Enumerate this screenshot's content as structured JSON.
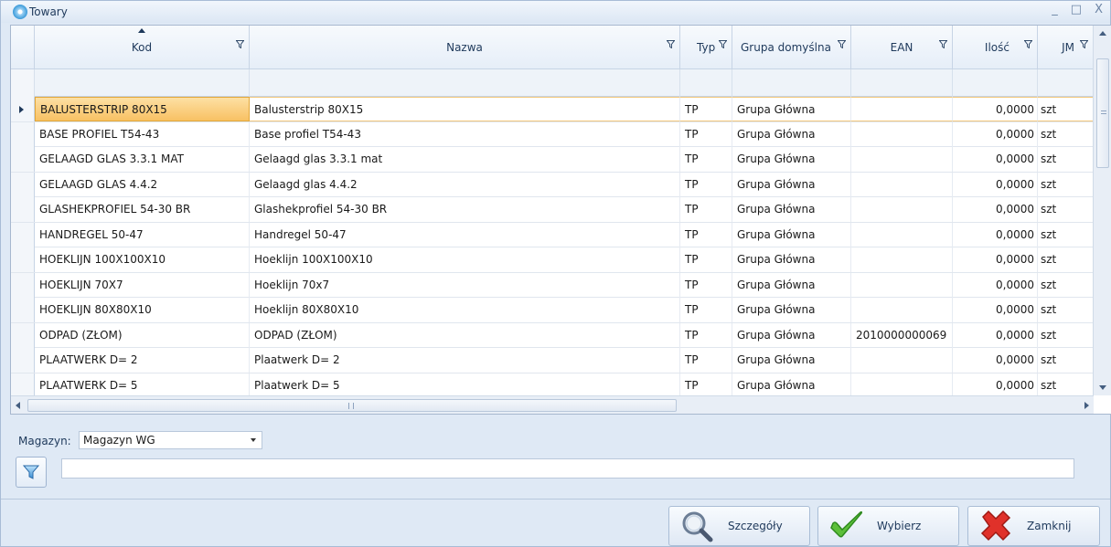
{
  "window": {
    "title": "Towary",
    "controls": [
      "_",
      "□",
      "X"
    ]
  },
  "grid": {
    "columns": [
      {
        "key": "kod",
        "label": "Kod",
        "sorted": "asc"
      },
      {
        "key": "nazwa",
        "label": "Nazwa"
      },
      {
        "key": "typ",
        "label": "Typ"
      },
      {
        "key": "grupa",
        "label": "Grupa domyślna"
      },
      {
        "key": "ean",
        "label": "EAN"
      },
      {
        "key": "ilosc",
        "label": "Ilość"
      },
      {
        "key": "jm",
        "label": "JM"
      }
    ],
    "rows": [
      {
        "kod": "BALUSTERSTRIP 80X15",
        "nazwa": "Balusterstrip 80X15",
        "typ": "TP",
        "grupa": "Grupa Główna",
        "ean": "",
        "ilosc": "0,0000",
        "jm": "szt",
        "active": true
      },
      {
        "kod": "BASE PROFIEL T54-43",
        "nazwa": "Base profiel T54-43",
        "typ": "TP",
        "grupa": "Grupa Główna",
        "ean": "",
        "ilosc": "0,0000",
        "jm": "szt"
      },
      {
        "kod": "GELAAGD GLAS 3.3.1 MAT",
        "nazwa": "Gelaagd glas 3.3.1 mat",
        "typ": "TP",
        "grupa": "Grupa Główna",
        "ean": "",
        "ilosc": "0,0000",
        "jm": "szt"
      },
      {
        "kod": "GELAAGD GLAS 4.4.2",
        "nazwa": "Gelaagd glas 4.4.2",
        "typ": "TP",
        "grupa": "Grupa Główna",
        "ean": "",
        "ilosc": "0,0000",
        "jm": "szt"
      },
      {
        "kod": "GLASHEKPROFIEL 54-30 BR",
        "nazwa": "Glashekprofiel 54-30 BR",
        "typ": "TP",
        "grupa": "Grupa Główna",
        "ean": "",
        "ilosc": "0,0000",
        "jm": "szt"
      },
      {
        "kod": "HANDREGEL 50-47",
        "nazwa": "Handregel 50-47",
        "typ": "TP",
        "grupa": "Grupa Główna",
        "ean": "",
        "ilosc": "0,0000",
        "jm": "szt"
      },
      {
        "kod": "HOEKLIJN 100X100X10",
        "nazwa": "Hoeklijn 100X100X10",
        "typ": "TP",
        "grupa": "Grupa Główna",
        "ean": "",
        "ilosc": "0,0000",
        "jm": "szt"
      },
      {
        "kod": "HOEKLIJN 70X7",
        "nazwa": "Hoeklijn 70x7",
        "typ": "TP",
        "grupa": "Grupa Główna",
        "ean": "",
        "ilosc": "0,0000",
        "jm": "szt"
      },
      {
        "kod": "HOEKLIJN 80X80X10",
        "nazwa": "Hoeklijn 80X80X10",
        "typ": "TP",
        "grupa": "Grupa Główna",
        "ean": "",
        "ilosc": "0,0000",
        "jm": "szt"
      },
      {
        "kod": "ODPAD (ZŁOM)",
        "nazwa": "ODPAD (ZŁOM)",
        "typ": "TP",
        "grupa": "Grupa Główna",
        "ean": "2010000000069",
        "ilosc": "0,0000",
        "jm": "szt"
      },
      {
        "kod": "PLAATWERK D= 2",
        "nazwa": "Plaatwerk D= 2",
        "typ": "TP",
        "grupa": "Grupa Główna",
        "ean": "",
        "ilosc": "0,0000",
        "jm": "szt"
      },
      {
        "kod": "PLAATWERK D= 5",
        "nazwa": "Plaatwerk D= 5",
        "typ": "TP",
        "grupa": "Grupa Główna",
        "ean": "",
        "ilosc": "0,0000",
        "jm": "szt"
      },
      {
        "kod": "",
        "nazwa": "",
        "typ": "",
        "grupa": "",
        "ean": "",
        "ilosc": "",
        "jm": ""
      }
    ]
  },
  "magazyn": {
    "label": "Magazyn:",
    "value": "Magazyn WG"
  },
  "filter": {
    "value": ""
  },
  "buttons": {
    "szczegoly": "Szczegóły",
    "wybierz": "Wybierz",
    "zamknij": "Zamknij"
  },
  "colors": {
    "accent": "#f8c163",
    "frame": "#dfe9f5",
    "header": "#e6eef8"
  }
}
